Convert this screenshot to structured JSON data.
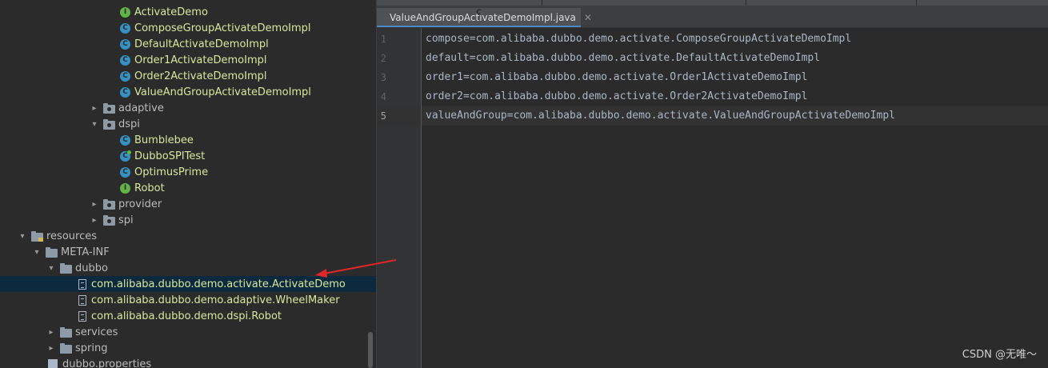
{
  "tree": {
    "items": [
      {
        "label": "ActivateDemo",
        "icon": "interface-icon",
        "name": "tree-item-activatedemo"
      },
      {
        "label": "ComposeGroupActivateDemoImpl",
        "icon": "class-icon",
        "name": "tree-item-composegroupactivatedemoimpl"
      },
      {
        "label": "DefaultActivateDemoImpl",
        "icon": "class-icon",
        "name": "tree-item-defaultactivatedemoimpl"
      },
      {
        "label": "Order1ActivateDemoImpl",
        "icon": "class-icon",
        "name": "tree-item-order1activatedemoimpl"
      },
      {
        "label": "Order2ActivateDemoImpl",
        "icon": "class-icon",
        "name": "tree-item-order2activatedemoimpl"
      },
      {
        "label": "ValueAndGroupActivateDemoImpl",
        "icon": "class-icon",
        "name": "tree-item-valueandgroupactivatedemoimpl"
      },
      {
        "label": "adaptive",
        "icon": "package-folder-icon",
        "name": "tree-item-adaptive"
      },
      {
        "label": "dspi",
        "icon": "package-folder-icon",
        "name": "tree-item-dspi"
      },
      {
        "label": "Bumblebee",
        "icon": "class-icon",
        "name": "tree-item-bumblebee"
      },
      {
        "label": "DubboSPITest",
        "icon": "test-class-icon",
        "name": "tree-item-dubbospitest"
      },
      {
        "label": "OptimusPrime",
        "icon": "class-icon",
        "name": "tree-item-optimusprime"
      },
      {
        "label": "Robot",
        "icon": "interface-icon",
        "name": "tree-item-robot"
      },
      {
        "label": "provider",
        "icon": "package-folder-icon",
        "name": "tree-item-provider"
      },
      {
        "label": "spi",
        "icon": "package-folder-icon",
        "name": "tree-item-spi"
      },
      {
        "label": "resources",
        "icon": "resources-folder-icon",
        "name": "tree-item-resources"
      },
      {
        "label": "META-INF",
        "icon": "folder-icon",
        "name": "tree-item-meta-inf"
      },
      {
        "label": "dubbo",
        "icon": "folder-icon",
        "name": "tree-item-dubbo"
      },
      {
        "label": "com.alibaba.dubbo.demo.activate.ActivateDemo",
        "icon": "text-file-icon",
        "name": "tree-item-activatedemo-file"
      },
      {
        "label": "com.alibaba.dubbo.demo.adaptive.WheelMaker",
        "icon": "text-file-icon",
        "name": "tree-item-wheelmaker-file"
      },
      {
        "label": "com.alibaba.dubbo.demo.dspi.Robot",
        "icon": "text-file-icon",
        "name": "tree-item-robot-file"
      },
      {
        "label": "services",
        "icon": "folder-icon",
        "name": "tree-item-services"
      },
      {
        "label": "spring",
        "icon": "folder-icon",
        "name": "tree-item-spring"
      },
      {
        "label": "dubbo.properties",
        "icon": "properties-file-icon",
        "name": "tree-item-dubbo-properties"
      }
    ],
    "selected": "com.alibaba.dubbo.demo.activate.ActivateDemo"
  },
  "editor": {
    "active_tab": "ValueAndGroupActivateDemoImpl.java",
    "current_line": 5,
    "lines": [
      {
        "num": "1",
        "text": "compose=com.alibaba.dubbo.demo.activate.ComposeGroupActivateDemoImpl"
      },
      {
        "num": "2",
        "text": "default=com.alibaba.dubbo.demo.activate.DefaultActivateDemoImpl"
      },
      {
        "num": "3",
        "text": "order1=com.alibaba.dubbo.demo.activate.Order1ActivateDemoImpl"
      },
      {
        "num": "4",
        "text": "order2=com.alibaba.dubbo.demo.activate.Order2ActivateDemoImpl"
      },
      {
        "num": "5",
        "text": "valueAndGroup=com.alibaba.dubbo.demo.activate.ValueAndGroupActivateDemoImpl"
      }
    ]
  },
  "watermark": "CSDN @无唯～",
  "colors": {
    "background": "#2b2b2b",
    "selection": "#0d293e",
    "tree_green_text": "#d6e89c",
    "annotation_arrow": "#e0262a"
  }
}
